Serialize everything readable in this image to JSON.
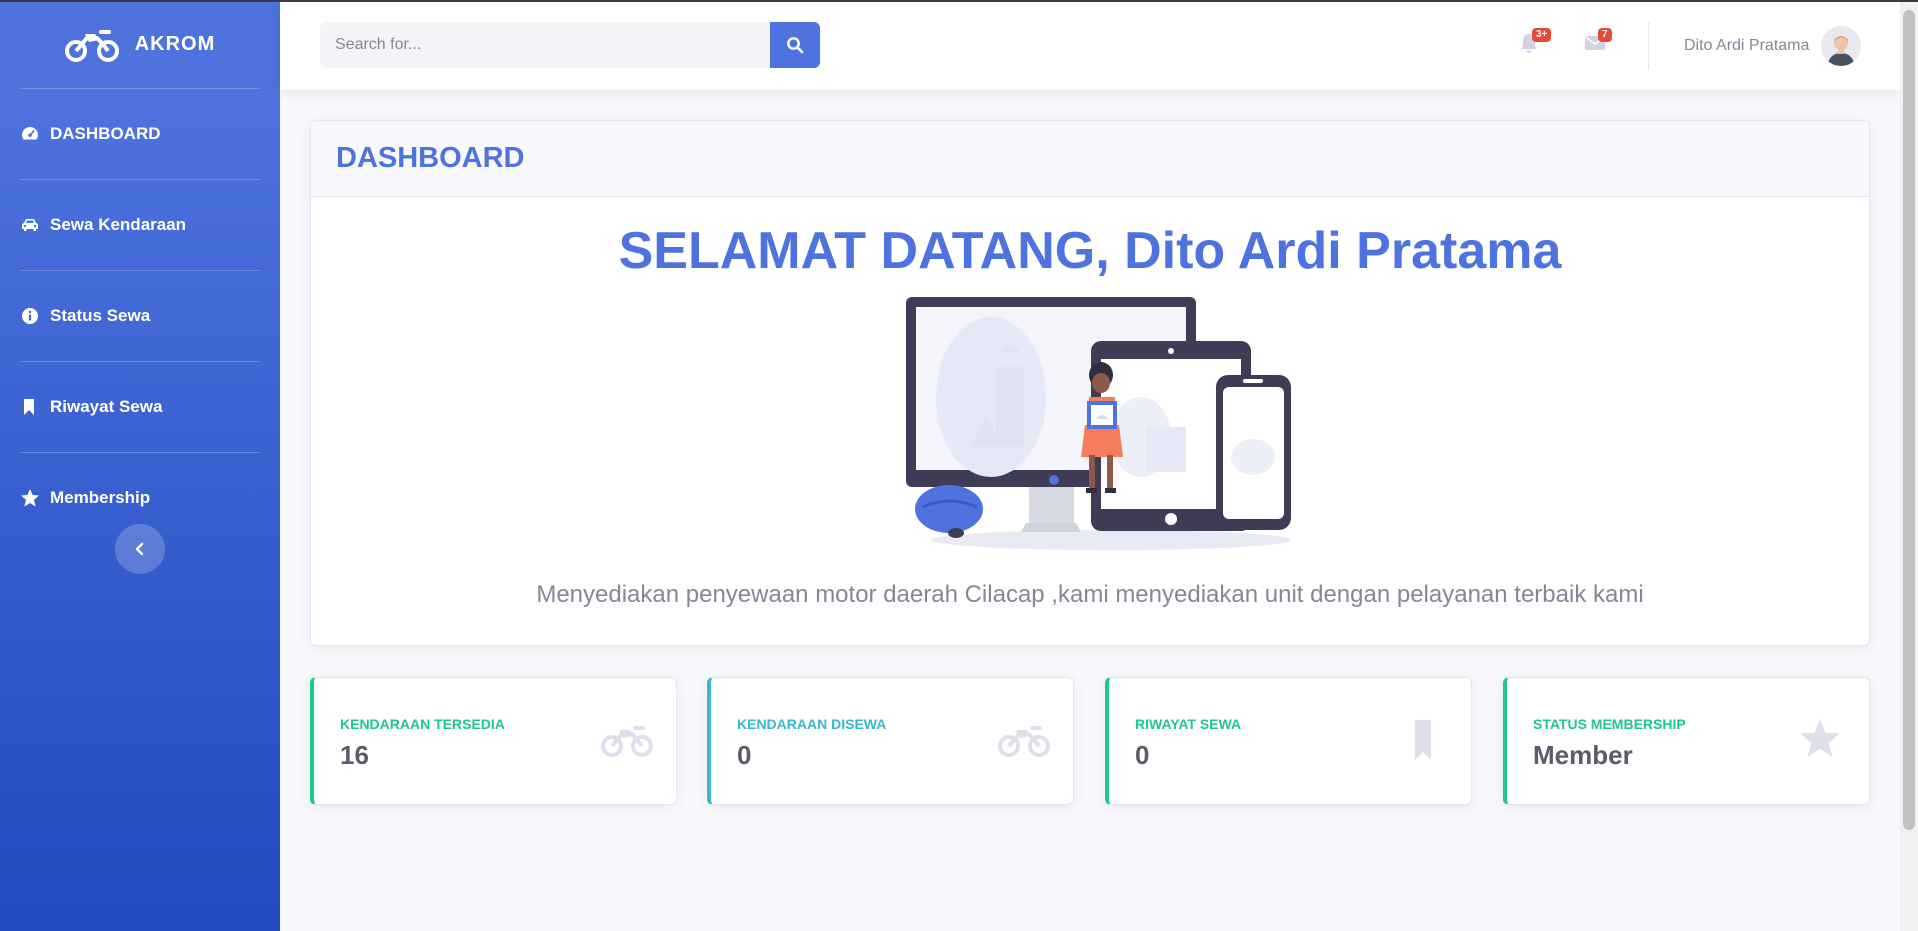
{
  "sidebar": {
    "brand": "AKROM",
    "items": [
      {
        "label": "DASHBOARD",
        "icon": "tachometer-icon"
      },
      {
        "label": "Sewa Kendaraan",
        "icon": "car-icon"
      },
      {
        "label": "Status Sewa",
        "icon": "info-circle-icon"
      },
      {
        "label": "Riwayat Sewa",
        "icon": "bookmark-icon"
      },
      {
        "label": "Membership",
        "icon": "star-icon"
      }
    ]
  },
  "topbar": {
    "search_placeholder": "Search for...",
    "alerts_badge": "3+",
    "messages_badge": "7",
    "user_name": "Dito Ardi Pratama"
  },
  "main": {
    "card_title": "DASHBOARD",
    "welcome": "SELAMAT DATANG, Dito Ardi Pratama",
    "description": "Menyediakan penyewaan motor daerah Cilacap ,kami menyediakan unit dengan pelayanan terbaik kami"
  },
  "stats": [
    {
      "label": "KENDARAAN TERSEDIA",
      "value": "16",
      "color": "#1cc88a",
      "icon": "motorcycle-icon"
    },
    {
      "label": "KENDARAAN DISEWA",
      "value": "0",
      "color": "#36b9cc",
      "icon": "motorcycle-icon"
    },
    {
      "label": "RIWAYAT SEWA",
      "value": "0",
      "color": "#1cc88a",
      "icon": "bookmark-icon"
    },
    {
      "label": "STATUS MEMBERSHIP",
      "value": "Member",
      "color": "#1cc88a",
      "icon": "star-icon"
    }
  ],
  "colors": {
    "primary": "#4e73df",
    "success": "#1cc88a",
    "info": "#36b9cc",
    "danger": "#e74a3b"
  }
}
